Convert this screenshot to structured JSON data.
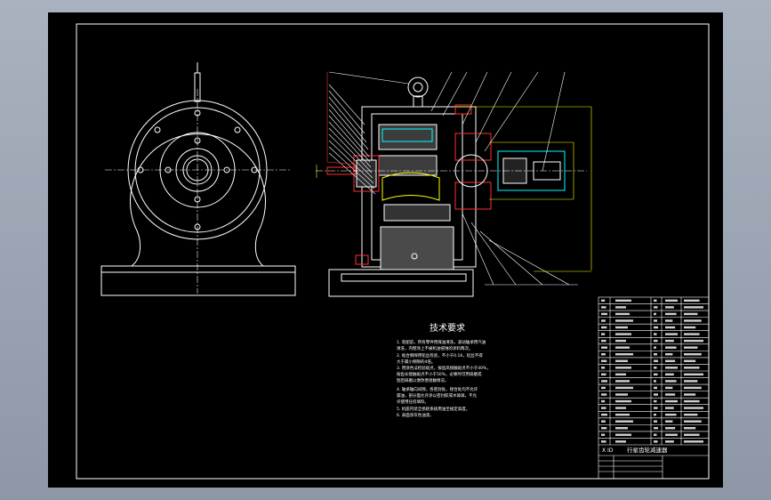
{
  "drawing": {
    "tech_title": "技术要求",
    "tech_notes": [
      "1. 装配前，所有零件用煤油清洗，滚动轴承用汽油",
      "清洗，内壁涂上不被机油侵蚀的涂料两次。",
      "2. 啮合侧隙用铅丝检验，不小于0.16，铅丝不得",
      "大于最小侧隙的4倍。",
      "3. 用涂色法检验斑点，按齿高接触斑点不小于40%，",
      "按齿长接触斑点不小于50%，必要时可用研磨或",
      "刮后研磨以便改善接触情况。",
      "4. 轴承轴向间隙，各密封处、接合处均不允许",
      "漏油，剖分面允许涂以密封胶或水玻璃，不允",
      "许使用任何填料。",
      "5. 机座内装全损耗系统用油至规定高度。",
      "6. 表面涂灰色油漆。"
    ],
    "title_block_name": "行星齿轮减速器",
    "title_block_prefix": "X ID"
  }
}
